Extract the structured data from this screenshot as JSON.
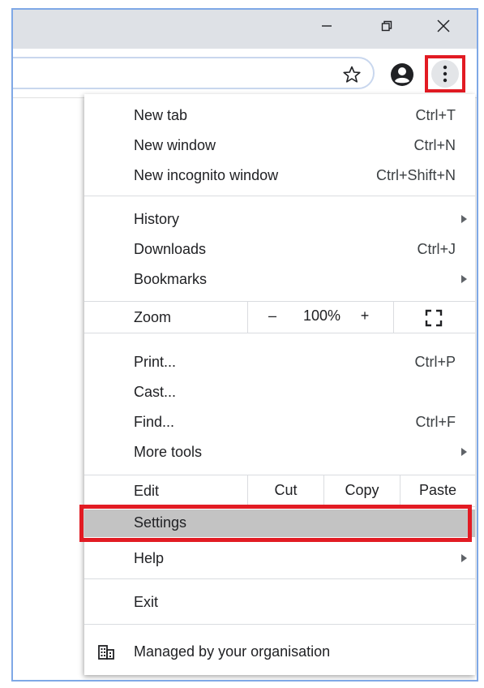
{
  "window": {
    "minimize_icon": "minimize-icon",
    "restore_icon": "restore-icon",
    "close_icon": "close-icon"
  },
  "toolbar": {
    "bookmark_icon": "star-icon",
    "profile_icon": "account-icon",
    "menu_icon": "three-dots-vertical-icon"
  },
  "menu": {
    "group1": [
      {
        "label": "New tab",
        "shortcut": "Ctrl+T"
      },
      {
        "label": "New window",
        "shortcut": "Ctrl+N"
      },
      {
        "label": "New incognito window",
        "shortcut": "Ctrl+Shift+N"
      }
    ],
    "group2": [
      {
        "label": "History",
        "shortcut": ""
      },
      {
        "label": "Downloads",
        "shortcut": "Ctrl+J"
      },
      {
        "label": "Bookmarks",
        "shortcut": ""
      }
    ],
    "zoom": {
      "label": "Zoom",
      "minus": "–",
      "value": "100%",
      "plus": "+"
    },
    "group3": [
      {
        "label": "Print...",
        "shortcut": "Ctrl+P"
      },
      {
        "label": "Cast...",
        "shortcut": ""
      },
      {
        "label": "Find...",
        "shortcut": "Ctrl+F"
      },
      {
        "label": "More tools",
        "shortcut": ""
      }
    ],
    "edit": {
      "label": "Edit",
      "cut": "Cut",
      "copy": "Copy",
      "paste": "Paste"
    },
    "settings": "Settings",
    "help": "Help",
    "exit": "Exit",
    "managed": "Managed by your organisation"
  },
  "colors": {
    "highlight_border": "#e21b23",
    "settings_hover": "#c3c3c3",
    "frame_border": "#7fa8e6",
    "titlebar": "#dee1e6"
  }
}
